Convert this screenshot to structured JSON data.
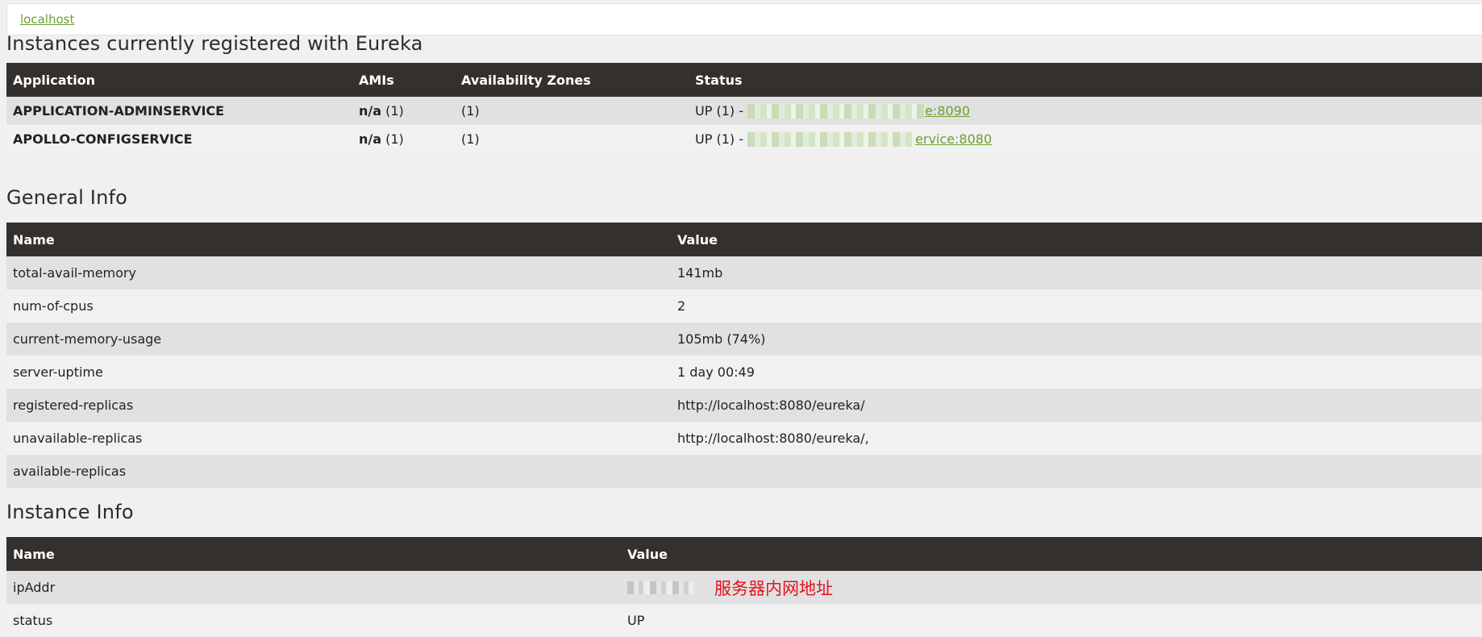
{
  "breadcrumb": {
    "link": "localhost"
  },
  "instances": {
    "title": "Instances currently registered with Eureka",
    "headers": [
      "Application",
      "AMIs",
      "Availability Zones",
      "Status"
    ],
    "rows": [
      {
        "application": "APPLICATION-ADMINSERVICE",
        "ami_value": "n/a",
        "ami_count": "(1)",
        "zones": "(1)",
        "status_prefix": "UP (1) -",
        "link_suffix": "e:8090"
      },
      {
        "application": "APOLLO-CONFIGSERVICE",
        "ami_value": "n/a",
        "ami_count": "(1)",
        "zones": "(1)",
        "status_prefix": "UP (1) -",
        "link_suffix": "ervice:8080"
      }
    ]
  },
  "general": {
    "title": "General Info",
    "headers": [
      "Name",
      "Value"
    ],
    "rows": [
      {
        "name": "total-avail-memory",
        "value": "141mb"
      },
      {
        "name": "num-of-cpus",
        "value": "2"
      },
      {
        "name": "current-memory-usage",
        "value": "105mb (74%)"
      },
      {
        "name": "server-uptime",
        "value": "1 day 00:49"
      },
      {
        "name": "registered-replicas",
        "value": "http://localhost:8080/eureka/"
      },
      {
        "name": "unavailable-replicas",
        "value": "http://localhost:8080/eureka/,"
      },
      {
        "name": "available-replicas",
        "value": ""
      }
    ]
  },
  "instance": {
    "title": "Instance Info",
    "headers": [
      "Name",
      "Value"
    ],
    "rows": [
      {
        "name": "ipAddr",
        "value": "",
        "annotation": "服务器内网地址"
      },
      {
        "name": "status",
        "value": "UP"
      }
    ]
  },
  "colors": {
    "header_bg": "#34302d",
    "link": "#6da02d",
    "annotation": "#e3121b"
  }
}
